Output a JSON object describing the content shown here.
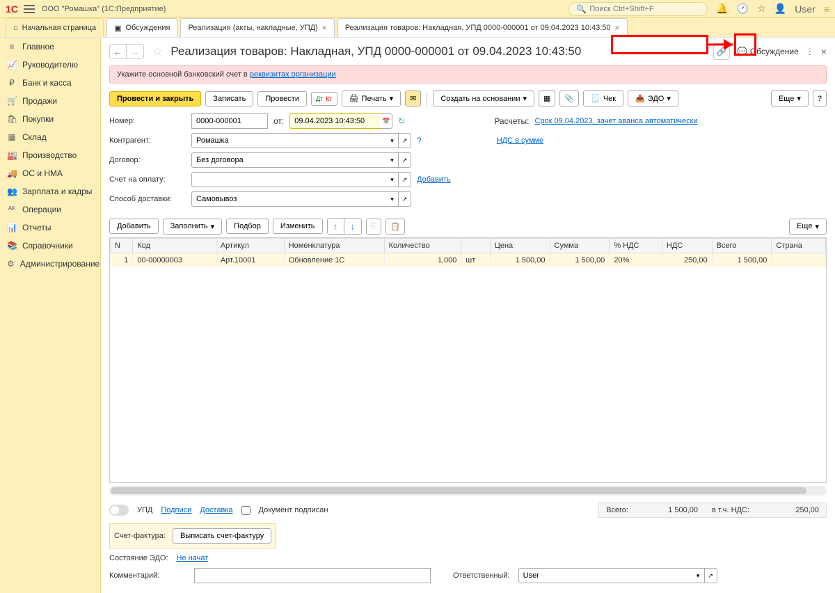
{
  "titlebar": {
    "company": "ООО \"Ромашка\"",
    "app": "(1С:Предприятие)",
    "search_placeholder": "Поиск Ctrl+Shift+F",
    "user": "User"
  },
  "tabs": {
    "home": "Начальная страница",
    "discuss": "Обсуждения",
    "t1": "Реализация (акты, накладные, УПД)",
    "t2": "Реализация товаров: Накладная, УПД 0000-000001 от 09.04.2023 10:43:50"
  },
  "sidebar": [
    {
      "icon": "≡",
      "label": "Главное"
    },
    {
      "icon": "📈",
      "label": "Руководителю"
    },
    {
      "icon": "₽",
      "label": "Банк и касса"
    },
    {
      "icon": "🛒",
      "label": "Продажи"
    },
    {
      "icon": "🛍",
      "label": "Покупки"
    },
    {
      "icon": "▦",
      "label": "Склад"
    },
    {
      "icon": "🏭",
      "label": "Производство"
    },
    {
      "icon": "🚚",
      "label": "ОС и НМА"
    },
    {
      "icon": "👥",
      "label": "Зарплата и кадры"
    },
    {
      "icon": "ᴬᴷ",
      "label": "Операции"
    },
    {
      "icon": "📊",
      "label": "Отчеты"
    },
    {
      "icon": "📚",
      "label": "Справочники"
    },
    {
      "icon": "⚙",
      "label": "Администрирование"
    }
  ],
  "doc": {
    "title": "Реализация товаров: Накладная, УПД 0000-000001 от 09.04.2023 10:43:50",
    "discuss": "Обсуждение"
  },
  "warning": {
    "text": "Укажите основной банковский счет в ",
    "link": "реквизитах организации"
  },
  "buttons": {
    "primary": "Провести и закрыть",
    "save": "Записать",
    "post": "Провести",
    "print": "Печать",
    "create_based": "Создать на основании",
    "check": "Чек",
    "edo": "ЭДО",
    "more": "Еще",
    "add": "Добавить",
    "fill": "Заполнить",
    "pick": "Подбор",
    "change": "Изменить",
    "write_invoice": "Выписать счет-фактуру"
  },
  "form": {
    "number_label": "Номер:",
    "number": "0000-000001",
    "from_label": "от:",
    "date": "09.04.2023 10:43:50",
    "calc_label": "Расчеты:",
    "calc_link": "Срок 09.04.2023, зачет аванса автоматически",
    "contragent_label": "Контрагент:",
    "contragent": "Ромашка",
    "nds_link": "НДС в сумме",
    "contract_label": "Договор:",
    "contract": "Без договора",
    "invoice_label": "Счет на оплату:",
    "invoice_add": "Добавить",
    "delivery_label": "Способ доставки:",
    "delivery": "Самовывоз"
  },
  "grid": {
    "headers": [
      "N",
      "Код",
      "Артикул",
      "Номенклатура",
      "Количество",
      "",
      "Цена",
      "Сумма",
      "% НДС",
      "НДС",
      "Всего",
      "Страна"
    ],
    "row": {
      "n": "1",
      "code": "00-00000003",
      "art": "Арт.10001",
      "nom": "Обновление 1С",
      "qty": "1,000",
      "unit": "шт",
      "price": "1 500,00",
      "sum": "1 500,00",
      "nds_pct": "20%",
      "nds": "250,00",
      "total": "1 500,00"
    }
  },
  "footer": {
    "upd": "УПД",
    "signs": "Подписи",
    "delivery": "Доставка",
    "doc_signed": "Документ подписан",
    "total_label": "Всего:",
    "total": "1 500,00",
    "nds_label": "в т.ч. НДС:",
    "nds": "250,00",
    "factura_label": "Счет-фактура:",
    "edo_state_label": "Состояние ЭДО:",
    "edo_state": "Не начат",
    "comment_label": "Комментарий:",
    "responsible_label": "Ответственный:",
    "responsible": "User"
  }
}
